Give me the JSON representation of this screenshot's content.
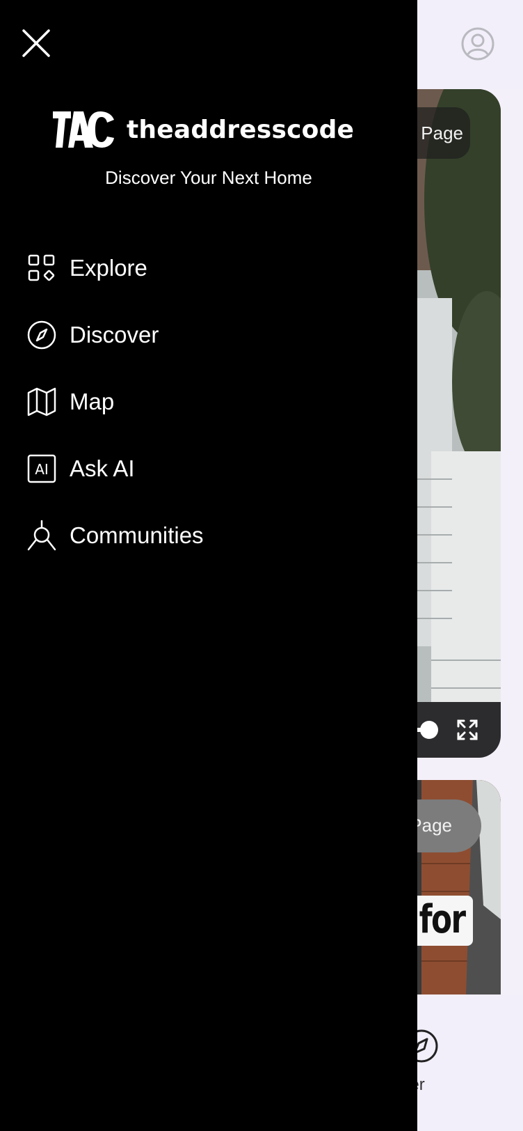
{
  "background": {
    "card1_button_label": "Page",
    "card2_button_label": "Page",
    "card2_sign_text": "for",
    "bottom_nav_discover_label": "cover"
  },
  "drawer": {
    "brand_name": "theaddresscode",
    "tagline": "Discover Your Next Home",
    "nav_items": [
      {
        "label": "Explore",
        "icon": "grid-icon"
      },
      {
        "label": "Discover",
        "icon": "compass-icon"
      },
      {
        "label": "Map",
        "icon": "map-icon"
      },
      {
        "label": "Ask AI",
        "icon": "ai-icon"
      },
      {
        "label": "Communities",
        "icon": "communities-icon"
      }
    ]
  },
  "colors": {
    "drawer_bg": "#000000",
    "drawer_text": "#ffffff",
    "page_bg": "#f3effa"
  }
}
